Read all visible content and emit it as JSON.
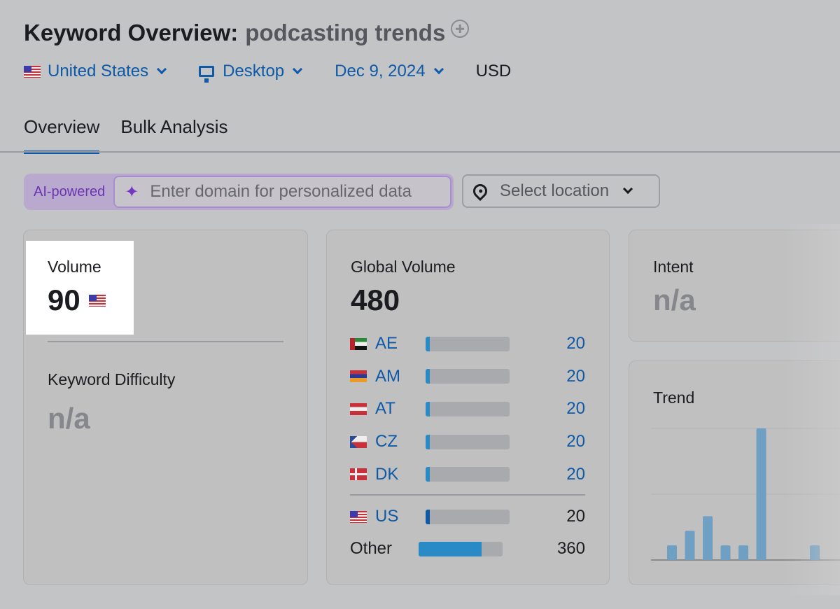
{
  "header": {
    "title": "Keyword Overview:",
    "keyword": "podcasting trends",
    "add_icon": "plus-circle-icon"
  },
  "filters": {
    "country": "United States",
    "device": "Desktop",
    "date": "Dec 9, 2024",
    "currency": "USD"
  },
  "tabs": [
    {
      "label": "Overview",
      "active": true
    },
    {
      "label": "Bulk Analysis",
      "active": false
    }
  ],
  "ai": {
    "badge": "AI-powered",
    "placeholder": "Enter domain for personalized data"
  },
  "location": {
    "placeholder": "Select location"
  },
  "volume": {
    "label": "Volume",
    "value": "90",
    "country_flag": "us"
  },
  "difficulty": {
    "label": "Keyword Difficulty",
    "value": "n/a"
  },
  "global": {
    "label": "Global Volume",
    "value": "480",
    "countries": [
      {
        "code": "AE",
        "value": "20",
        "share": 0.042
      },
      {
        "code": "AM",
        "value": "20",
        "share": 0.042
      },
      {
        "code": "AT",
        "value": "20",
        "share": 0.042
      },
      {
        "code": "CZ",
        "value": "20",
        "share": 0.042
      },
      {
        "code": "DK",
        "value": "20",
        "share": 0.042
      }
    ],
    "us": {
      "code": "US",
      "value": "20",
      "share": 0.042
    },
    "other": {
      "label": "Other",
      "value": "360",
      "share": 0.75
    }
  },
  "intent": {
    "label": "Intent",
    "value": "n/a"
  },
  "trend": {
    "label": "Trend"
  },
  "chart_data": {
    "type": "bar",
    "title": "Trend",
    "values": [
      1,
      2,
      3,
      1,
      1,
      9,
      0,
      0,
      1
    ],
    "ylim": [
      0,
      9
    ],
    "grid": true,
    "color": "#6f9fc2"
  },
  "colors": {
    "accent": "#0e5aa7",
    "bar_fill": "#2a8ac5",
    "ai_purple": "#7435c4"
  }
}
